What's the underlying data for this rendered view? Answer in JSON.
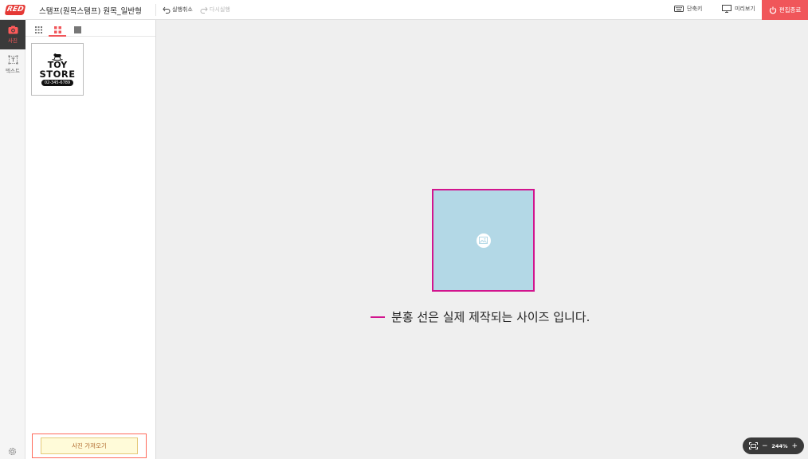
{
  "app": {
    "logo_text": "RED",
    "document_title": "스탬프(원목스탬프) 원목_일반형"
  },
  "toolbar": {
    "undo_label": "실행취소",
    "redo_label": "다시실행",
    "shortcut_label": "단축키",
    "preview_label": "미리보기",
    "exit_label": "편집종료"
  },
  "rail": {
    "items": [
      {
        "label": "사진",
        "icon": "camera-icon",
        "active": true
      },
      {
        "label": "텍스트",
        "icon": "text-box-icon",
        "active": false
      }
    ]
  },
  "panel": {
    "view_modes": [
      "grid-small",
      "grid-medium",
      "grid-large"
    ],
    "active_view": "grid-medium",
    "thumbnail": {
      "line1": "TOY",
      "line2": "STORE",
      "phone": "02-345-6789"
    },
    "upload_label": "사진 가져오기"
  },
  "canvas": {
    "notice": "분홍 선은 실제 제작되는 사이즈 입니다.",
    "zoom": "244%",
    "guide_color": "#d2148e",
    "fill_color": "#b3d8e6"
  },
  "colors": {
    "accent": "#f0565a",
    "rail_active_bg": "#3a3a3a"
  }
}
